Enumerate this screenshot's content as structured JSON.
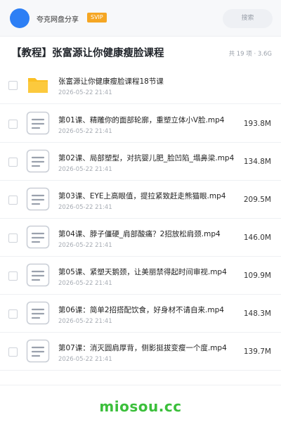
{
  "header": {
    "app_name": "夸克网盘分享",
    "badge": "SVIP",
    "search_placeholder": "搜索"
  },
  "share": {
    "title": "【教程】张富源让你健康瘦脸课程",
    "meta": "共 19 项 · 3.6G"
  },
  "files": [
    {
      "type": "folder",
      "name": "张富源让你健康瘦脸课程18节课",
      "date": "2026-05-22 21:41",
      "size": ""
    },
    {
      "type": "doc",
      "name": "第01课、精雕你的面部轮廓，重塑立体小V脸.mp4",
      "date": "2026-05-22 21:41",
      "size": "193.8M"
    },
    {
      "type": "doc",
      "name": "第02课、局部塑型，对抗婴儿肥_脸凹陷_塌鼻梁.mp4",
      "date": "2026-05-22 21:41",
      "size": "134.8M"
    },
    {
      "type": "doc",
      "name": "第03课、EYE上高眼值，提拉紧致赶走熊猫眼.mp4",
      "date": "2026-05-22 21:41",
      "size": "209.5M"
    },
    {
      "type": "doc",
      "name": "第04课、脖子僵硬_肩部酸痛？2招放松肩颈.mp4",
      "date": "2026-05-22 21:41",
      "size": "146.0M"
    },
    {
      "type": "doc",
      "name": "第05课、紧塑天鹅颈，让美丽禁得起时间审视.mp4",
      "date": "2026-05-22 21:41",
      "size": "109.9M"
    },
    {
      "type": "doc",
      "name": "第06课：简单2招搭配饮食，好身材不请自来.mp4",
      "date": "2026-05-22 21:41",
      "size": "148.3M"
    },
    {
      "type": "doc",
      "name": "第07课：消灭圆肩厚背，侧影挺拔变瘦一个度.mp4",
      "date": "2026-05-22 21:41",
      "size": "139.7M"
    }
  ],
  "watermark": "miosou.cc",
  "colors": {
    "accent": "#2d7ff5",
    "svip": "#f5a623",
    "folder": "#fbbf24",
    "watermark": "#3bbf3b"
  }
}
